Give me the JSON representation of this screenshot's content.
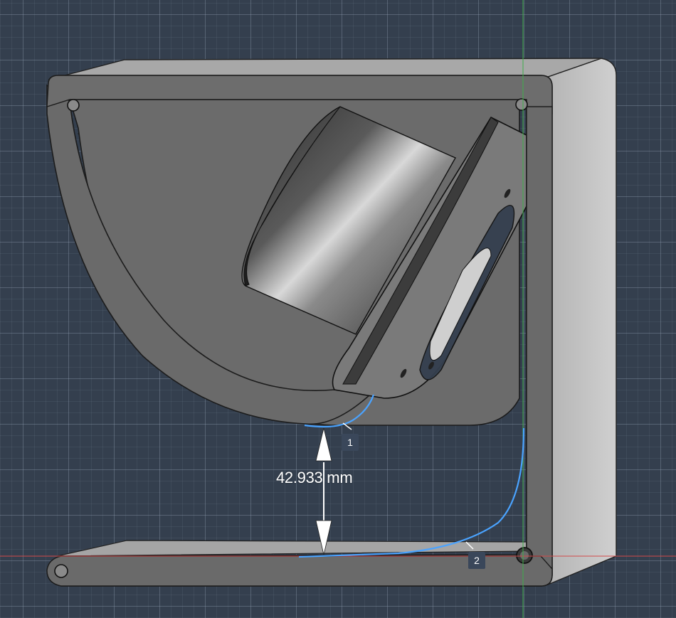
{
  "viewport": {
    "background_color": "#343f4e",
    "grid_color": "#96a5b9",
    "x_axis_color": "#d24a4a",
    "y_axis_color": "#3fae4a",
    "selection_color": "#4aa3ff"
  },
  "measurement": {
    "distance_label": "42.933 mm"
  },
  "edge_tags": [
    {
      "label": "1"
    },
    {
      "label": "2"
    }
  ]
}
